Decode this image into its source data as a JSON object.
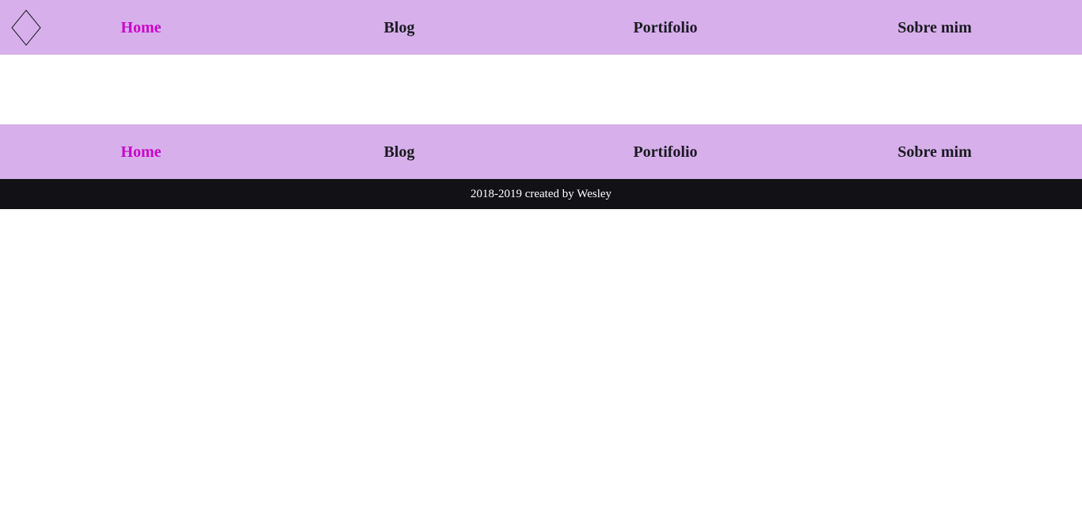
{
  "header": {
    "logo_icon": "diamond-outline-icon",
    "nav": [
      {
        "label": "Home",
        "active": true
      },
      {
        "label": "Blog",
        "active": false
      },
      {
        "label": "Portifolio",
        "active": false
      },
      {
        "label": "Sobre mim",
        "active": false
      }
    ]
  },
  "footer": {
    "nav": [
      {
        "label": "Home",
        "active": true
      },
      {
        "label": "Blog",
        "active": false
      },
      {
        "label": "Portifolio",
        "active": false
      },
      {
        "label": "Sobre mim",
        "active": false
      }
    ],
    "copyright": "2018-2019 created by Wesley"
  },
  "colors": {
    "nav_background": "#d7b0eb",
    "active_link": "#cc00cc",
    "link": "#1c1a24",
    "copyright_background": "#121116",
    "copyright_text": "#ffffff"
  }
}
